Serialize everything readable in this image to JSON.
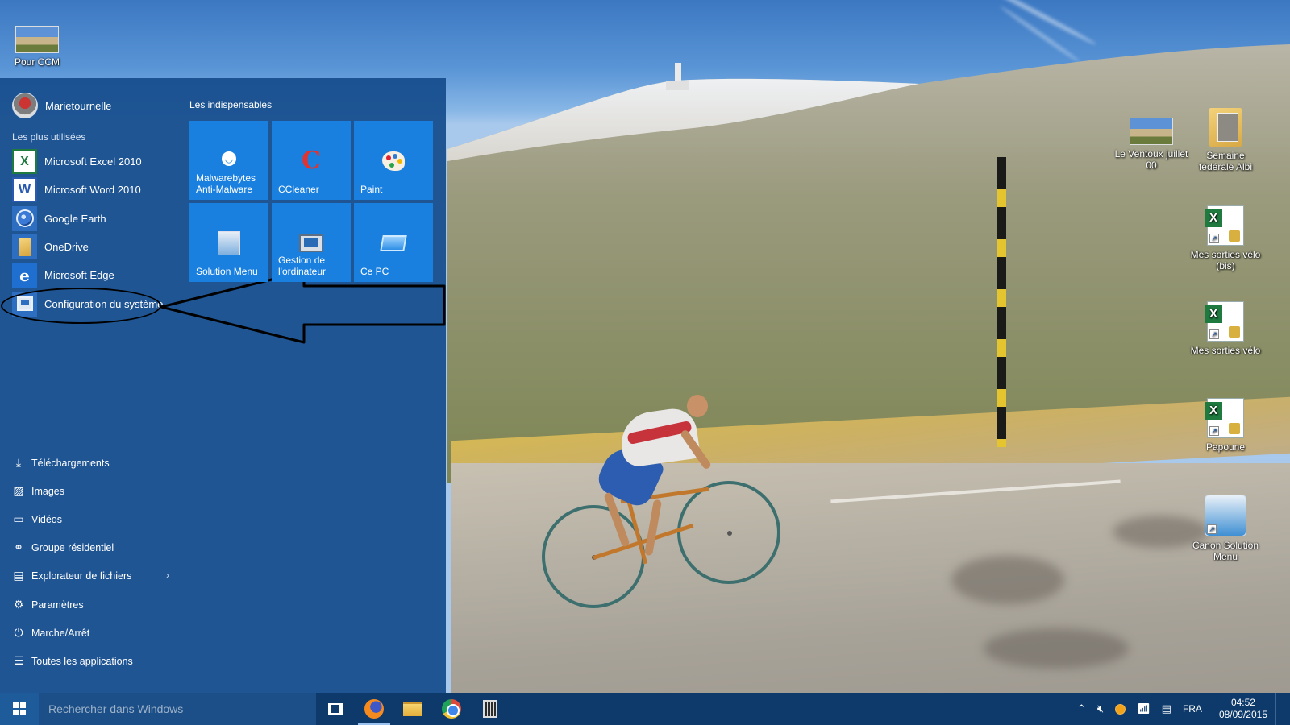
{
  "desktop": {
    "icons": [
      {
        "id": "pour-ccm",
        "label": "Pour CCM",
        "kind": "photo"
      },
      {
        "id": "ventoux",
        "label": "Le Ventoux juillet 00",
        "kind": "photo"
      },
      {
        "id": "semaine",
        "label": "Semaine fédérale Albi",
        "kind": "folder"
      },
      {
        "id": "sorties-bis",
        "label": "Mes sorties vélo (bis)",
        "kind": "excel"
      },
      {
        "id": "sorties",
        "label": "Mes sorties vélo",
        "kind": "excel"
      },
      {
        "id": "papoune",
        "label": "Papoune",
        "kind": "excel"
      },
      {
        "id": "canon",
        "label": "Canon Solution Menu",
        "kind": "app"
      }
    ]
  },
  "start_menu": {
    "user_name": "Marietournelle",
    "most_used_label": "Les plus utilisées",
    "apps": [
      {
        "label": "Microsoft Excel 2010",
        "icon": "excel-icon",
        "glyph": "X"
      },
      {
        "label": "Microsoft Word 2010",
        "icon": "word-icon",
        "glyph": "W"
      },
      {
        "label": "Google Earth",
        "icon": "google-earth-icon",
        "glyph": ""
      },
      {
        "label": "OneDrive",
        "icon": "onedrive-icon",
        "glyph": ""
      },
      {
        "label": "Microsoft Edge",
        "icon": "edge-icon",
        "glyph": "e"
      },
      {
        "label": "Configuration du système",
        "icon": "system-config-icon",
        "glyph": ""
      }
    ],
    "tiles_label": "Les indispensables",
    "tiles": [
      {
        "label": "Malwarebytes Anti-Malware",
        "label_line1": "Malwarebytes",
        "label_line2": "Anti-Malware",
        "icon": "malwarebytes-icon",
        "glyph": "◡"
      },
      {
        "label": "CCleaner",
        "icon": "ccleaner-icon",
        "glyph": "C"
      },
      {
        "label": "Paint",
        "icon": "paint-icon"
      },
      {
        "label": "Solution Menu",
        "icon": "canon-solution-menu-icon"
      },
      {
        "label": "Gestion de l'ordinateur",
        "label_line1": "Gestion de",
        "label_line2": "l'ordinateur",
        "icon": "computer-management-icon"
      },
      {
        "label": "Ce PC",
        "icon": "this-pc-icon"
      }
    ],
    "places": [
      {
        "label": "Téléchargements",
        "icon": "download-icon",
        "glyph": "⤓"
      },
      {
        "label": "Images",
        "icon": "images-icon",
        "glyph": "▨"
      },
      {
        "label": "Vidéos",
        "icon": "videos-icon",
        "glyph": "▭"
      },
      {
        "label": "Groupe résidentiel",
        "icon": "homegroup-icon",
        "glyph": "⚭"
      },
      {
        "label": "Explorateur de fichiers",
        "icon": "file-explorer-icon",
        "glyph": "▤",
        "chevron": "›"
      },
      {
        "label": "Paramètres",
        "icon": "settings-gear-icon",
        "glyph": "⚙"
      },
      {
        "label": "Marche/Arrêt",
        "icon": "power-icon",
        "glyph": "⏻"
      },
      {
        "label": "Toutes les applications",
        "icon": "all-apps-icon",
        "glyph": "☰"
      }
    ],
    "annotation": {
      "color": "#000000",
      "target": "Configuration du système"
    }
  },
  "taskbar": {
    "search_placeholder": "Rechercher dans Windows",
    "pinned": [
      "task-view",
      "firefox",
      "file-explorer",
      "chrome",
      "calculator"
    ],
    "tray": {
      "language": "FRA",
      "time": "04:52",
      "date": "08/09/2015"
    }
  },
  "colors": {
    "start_bg": "#164c8c",
    "tile_blue": "#1a80e0",
    "taskbar_bg": "#0d3a6b"
  }
}
